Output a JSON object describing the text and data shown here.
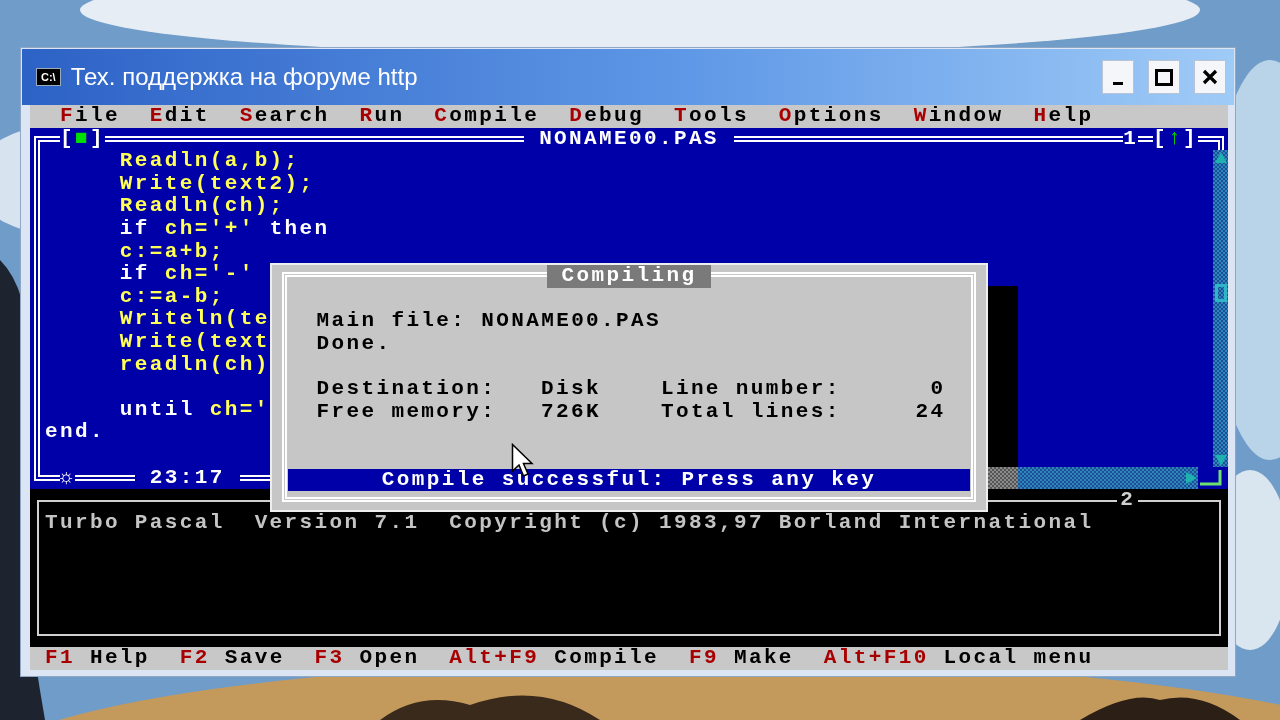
{
  "window": {
    "icon_label": "C:\\",
    "title": "Тех. поддержка на форуме http"
  },
  "menu": [
    {
      "label": "File"
    },
    {
      "label": "Edit"
    },
    {
      "label": "Search"
    },
    {
      "label": "Run"
    },
    {
      "label": "Compile"
    },
    {
      "label": "Debug"
    },
    {
      "label": "Tools"
    },
    {
      "label": "Options"
    },
    {
      "label": "Window"
    },
    {
      "label": "Help"
    }
  ],
  "editor": {
    "close_box": "[■]",
    "title": "NONAME00.PAS",
    "window_number": "1",
    "zoom_box": "[↑]",
    "modified_mark": "☼",
    "cursor_position": "23:17",
    "lines": [
      {
        "kind": "code",
        "tokens": [
          {
            "kind": "code",
            "text": "     Readln(a,b);"
          }
        ]
      },
      {
        "kind": "code",
        "tokens": [
          {
            "kind": "code",
            "text": "     Write(text2);"
          }
        ]
      },
      {
        "kind": "code",
        "tokens": [
          {
            "kind": "code",
            "text": "     Readln(ch);"
          }
        ]
      },
      {
        "kind": "code",
        "tokens": [
          {
            "kind": "keyword",
            "text": "     if"
          },
          {
            "kind": "code",
            "text": " ch='+' "
          },
          {
            "kind": "keyword",
            "text": "then"
          }
        ]
      },
      {
        "kind": "code",
        "tokens": [
          {
            "kind": "code",
            "text": "     c:=a+b;"
          }
        ]
      },
      {
        "kind": "code",
        "tokens": [
          {
            "kind": "keyword",
            "text": "     if"
          },
          {
            "kind": "code",
            "text": " ch='-'"
          }
        ]
      },
      {
        "kind": "code",
        "tokens": [
          {
            "kind": "code",
            "text": "     c:=a-b;"
          }
        ]
      },
      {
        "kind": "code",
        "tokens": [
          {
            "kind": "code",
            "text": "     Writeln(te"
          }
        ]
      },
      {
        "kind": "code",
        "tokens": [
          {
            "kind": "code",
            "text": "     Write(text"
          }
        ]
      },
      {
        "kind": "code",
        "tokens": [
          {
            "kind": "code",
            "text": "     readln(ch)"
          }
        ]
      },
      {
        "kind": "blank"
      },
      {
        "kind": "code",
        "tokens": [
          {
            "kind": "keyword",
            "text": "     until"
          },
          {
            "kind": "code",
            "text": " ch='"
          }
        ]
      },
      {
        "kind": "code",
        "tokens": [
          {
            "kind": "keyword",
            "text": "end."
          }
        ]
      }
    ]
  },
  "dialog": {
    "title": "Compiling",
    "lines": [
      "Main file: NONAME00.PAS",
      "Done."
    ],
    "stats": [
      {
        "label": "Destination:",
        "value": "Disk"
      },
      {
        "label": "Line number:",
        "value": "0"
      },
      {
        "label": "Free memory:",
        "value": "726K"
      },
      {
        "label": "Total lines:",
        "value": "24"
      }
    ],
    "status": "Compile successful: Press any key"
  },
  "output": {
    "window_number": "2",
    "lines": [
      "Turbo Pascal  Version 7.1  Copyright (c) 1983,97 Borland International"
    ]
  },
  "status_bar": [
    {
      "key": "F1",
      "label": "Help"
    },
    {
      "key": "F2",
      "label": "Save"
    },
    {
      "key": "F3",
      "label": "Open"
    },
    {
      "key": "Alt+F9",
      "label": "Compile"
    },
    {
      "key": "F9",
      "label": "Make"
    },
    {
      "key": "Alt+F10",
      "label": "Local menu"
    }
  ]
}
